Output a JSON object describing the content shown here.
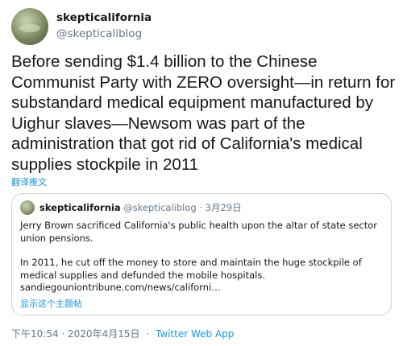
{
  "author": {
    "display_name": "skepticalifornia",
    "handle": "@skepticaliblog"
  },
  "tweet": {
    "text": "Before sending $1.4 billion to the Chinese Communist Party with ZERO oversight—in return for substandard medical equipment manufactured by Uighur slaves—Newsom was part of the administration that got rid of California's medical supplies stockpile in 2011",
    "translate_label": "翻译推文"
  },
  "quoted_tweet": {
    "display_name": "skepticalifornia",
    "handle": "@skepticaliblog",
    "separator": "·",
    "date": "3月29日",
    "paragraph1": "Jerry Brown sacrificed California's public health upon the altar of state sector union pensions.",
    "paragraph2": "In 2011, he cut off the money to store and maintain the huge stockpile of medical supplies and defunded the mobile hospitals.",
    "link": "sandiegouniontribune.com/news/californi…",
    "show_thread_label": "显示这个主题帖"
  },
  "footer": {
    "timestamp": "下午10:54 · 2020年4月15日",
    "separator": "·",
    "source": "Twitter Web App"
  },
  "colors": {
    "link_blue": "#1b95e0",
    "secondary_gray": "#657786",
    "border": "#ccd6dd"
  }
}
